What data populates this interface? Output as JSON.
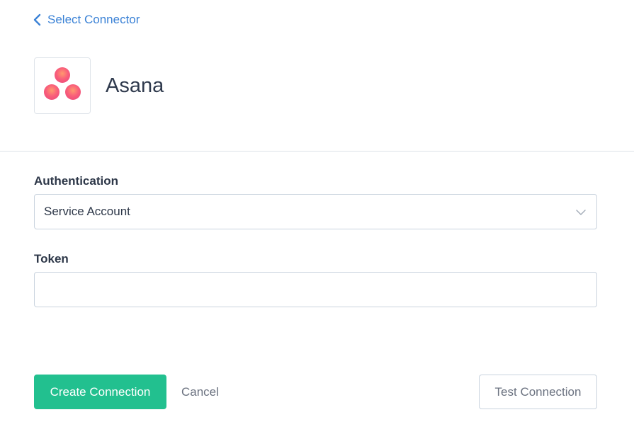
{
  "navigation": {
    "back_label": "Select Connector",
    "back_icon": "chevron-left-icon"
  },
  "connector": {
    "name": "Asana",
    "logo_icon": "asana-logo-icon",
    "logo_colors": [
      "#f95f7a",
      "#fc7f66",
      "#f06a6a"
    ]
  },
  "form": {
    "authentication": {
      "label": "Authentication",
      "selected_value": "Service Account"
    },
    "token": {
      "label": "Token",
      "value": "",
      "placeholder": ""
    }
  },
  "actions": {
    "create_label": "Create Connection",
    "cancel_label": "Cancel",
    "test_label": "Test Connection"
  },
  "colors": {
    "accent": "#22c08f",
    "link": "#3b82d6",
    "border": "#c9d3de"
  }
}
